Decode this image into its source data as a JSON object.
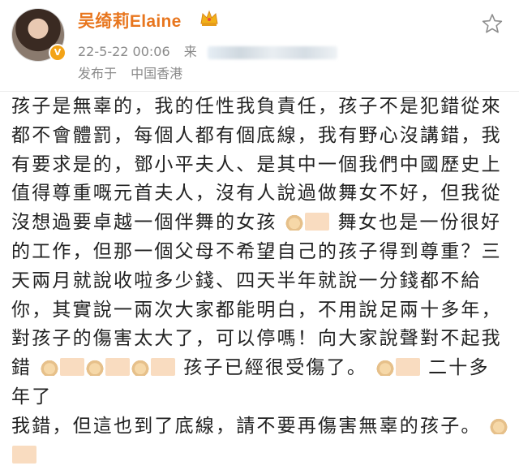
{
  "post": {
    "username": "吴绮莉Elaine",
    "date": "22-5-22 00:06",
    "source_prefix": "来",
    "location_prefix": "发布于",
    "location": "中国香港"
  },
  "content": {
    "lines": [
      "孩子是無辜的，我的任性我負責任，孩子不是犯錯從來",
      "都不會體罰，每個人都有個底線，我有野心沒講錯，我",
      "有要求是的，鄧小平夫人、是其中一個我們中國歷史上",
      "值得尊重嘅元首夫人，沒有人說過做舞女不好，但我從",
      "沒想過要卓越一個伴舞的女孩",
      "舞女也是一份很好",
      "的工作，但那一個父母不希望自己的孩子得到尊重？三",
      "天兩月就說收啦多少錢、四天半年就說一分錢都不給",
      "你，其實說一兩次大家都能明白，不用說足兩十多年，",
      "對孩子的傷害太大了，可以停嗎！向大家說聲對不起我",
      "錯",
      "孩子已經很受傷了。",
      "二十多年了",
      "我錯，但這也到了底線，請不要再傷害無辜的孩子。"
    ]
  },
  "icons": {
    "verified": "verified-badge-icon",
    "crown": "crown-icon",
    "favorite": "star-icon",
    "emoji": "folded-hands-emoji-icon"
  },
  "colors": {
    "username": "#e8761e",
    "meta": "#8a8a8a",
    "text": "#222222"
  }
}
